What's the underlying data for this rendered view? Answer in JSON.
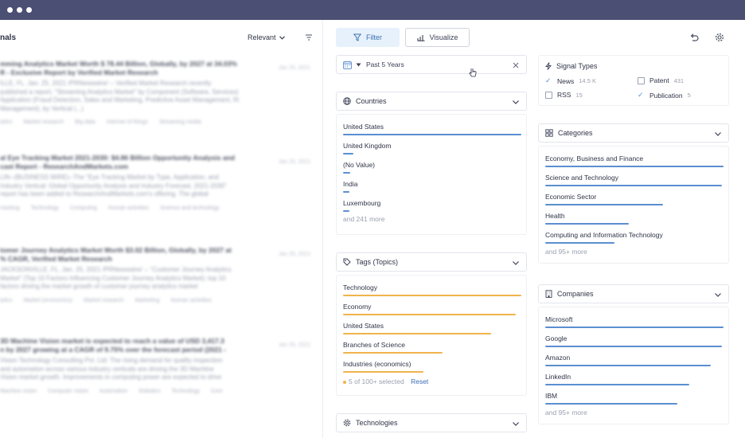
{
  "window": {
    "dots": [
      "dot",
      "dot",
      "dot"
    ]
  },
  "results_panel": {
    "title": "nals",
    "sort_label": "Relevant",
    "results": [
      {
        "title1": "mming Analytics Market Worth $ 78.44 Billion, Globally, by 2027 at 34.03%",
        "title2": "R - Exclusive Report by Verified Market Research",
        "text1": "ILLE, FL. Jan. 25, 2021 /PRNewswire/ -- Verified Market Research recently",
        "text2": "published a report, \"Streaming Analytics Market\" by Component (Software, Services), by",
        "text3": "Application (Fraud Detection, Sales and Marketing, Predictive Asset Management, Risk",
        "text4": "Management), by Vertical (...)",
        "tags": [
          "lytics",
          "Market research",
          "Big data",
          "Internet of things",
          "Streaming media"
        ],
        "meta": "Jan 25, 2021"
      },
      {
        "title1": "al Eye Tracking Market 2021-2030: $4.86 Billion Opportunity Analysis and",
        "title2": "cast Report - ResearchAndMarkets.com",
        "text1": "LIN--(BUSINESS WIRE)--The \"Eye Tracking Market by Type, Application, and",
        "text2": "Industry Vertical: Global Opportunity Analysis and Industry Forecast, 2021-2030\"",
        "text3": "report has been added to ResearchAndMarkets.com's offering. The global",
        "text4": "",
        "tags": [
          "tracking",
          "Technology",
          "Computing",
          "Human activities",
          "Science and technology"
        ],
        "meta": "Jan 25, 2021"
      },
      {
        "title1": "tomer Journey Analytics Market Worth $3.02 Billion, Globally, by 2027 at",
        "title2": "% CAGR, Verified Market Research",
        "text1": "JACKSONVILLE, FL. Jan. 25, 2021 /PRNewswire/ -- \"Customer Journey Analytics",
        "text2": "Market\" (Top 10 Factors Influencing Customer Journey Analytics Market); top 10",
        "text3": "factors driving the market growth of customer journey analytics market",
        "text4": "",
        "tags": [
          "lytics",
          "Market (economics)",
          "Market research",
          "Marketing",
          "Human activities"
        ],
        "meta": "Jan 25, 2021"
      },
      {
        "title1": "3D Machine Vision market is expected to reach a value of USD 3,417.3",
        "title2": "n by 2027 growing at a CAGR of 9.75% over the forecast period (2021 -",
        "text1": "Vision Technology Consulting Pvt. Ltd: The rising demand for quality inspection",
        "text2": "and automation across various industry verticals are driving the 3D Machine",
        "text3": "Vision market growth. Improvements in computing power are expected to drive",
        "text4": "",
        "tags": [
          "Machine vision",
          "Computer vision",
          "Automation",
          "Robotics",
          "Technology",
          "Com"
        ],
        "meta": "Jan 25, 2021"
      }
    ]
  },
  "toolbar": {
    "filter_label": "Filter",
    "visualize_label": "Visualize"
  },
  "date_filter": {
    "label": "Past 5 Years"
  },
  "countries": {
    "title": "Countries",
    "items": [
      {
        "label": "United States",
        "fill": 1.0
      },
      {
        "label": "United Kingdom",
        "fill": 0.06
      },
      {
        "label": "(No Value)",
        "fill": 0.04
      },
      {
        "label": "India",
        "fill": 0.03
      },
      {
        "label": "Luxembourg",
        "fill": 0.02
      }
    ],
    "more": "and 241 more"
  },
  "tags_topics": {
    "title": "Tags (Topics)",
    "items": [
      {
        "label": "Technology",
        "fill": 1.0
      },
      {
        "label": "Economy",
        "fill": 0.97
      },
      {
        "label": "United States",
        "fill": 0.83
      },
      {
        "label": "Branches of Science",
        "fill": 0.56
      },
      {
        "label": "Industries (economics)",
        "fill": 0.45
      }
    ],
    "selected": "5 of 100+ selected",
    "reset": "Reset"
  },
  "technologies": {
    "title": "Technologies"
  },
  "signal_types": {
    "title": "Signal Types",
    "items": [
      {
        "label": "News",
        "count": "14.5 K",
        "checked": true
      },
      {
        "label": "Patent",
        "count": "431",
        "checked": false
      },
      {
        "label": "RSS",
        "count": "15",
        "checked": false
      },
      {
        "label": "Publication",
        "count": "5",
        "checked": true
      }
    ]
  },
  "categories": {
    "title": "Categories",
    "items": [
      {
        "label": "Economy, Business and Finance",
        "fill": 1.0
      },
      {
        "label": "Science and Technology",
        "fill": 0.99
      },
      {
        "label": "Economic Sector",
        "fill": 0.66
      },
      {
        "label": "Health",
        "fill": 0.47
      },
      {
        "label": "Computing and Information Technology",
        "fill": 0.39
      }
    ],
    "more": "and 95+ more"
  },
  "companies": {
    "title": "Companies",
    "items": [
      {
        "label": "Microsoft",
        "fill": 1.0
      },
      {
        "label": "Google",
        "fill": 0.99
      },
      {
        "label": "Amazon",
        "fill": 0.93
      },
      {
        "label": "LinkedIn",
        "fill": 0.81
      },
      {
        "label": "IBM",
        "fill": 0.74
      }
    ],
    "more": "and 95+ more"
  },
  "colors": {
    "accent_blue": "#5b8fd0",
    "accent_orange": "#f0b44c",
    "titlebar": "#4b4f73"
  }
}
